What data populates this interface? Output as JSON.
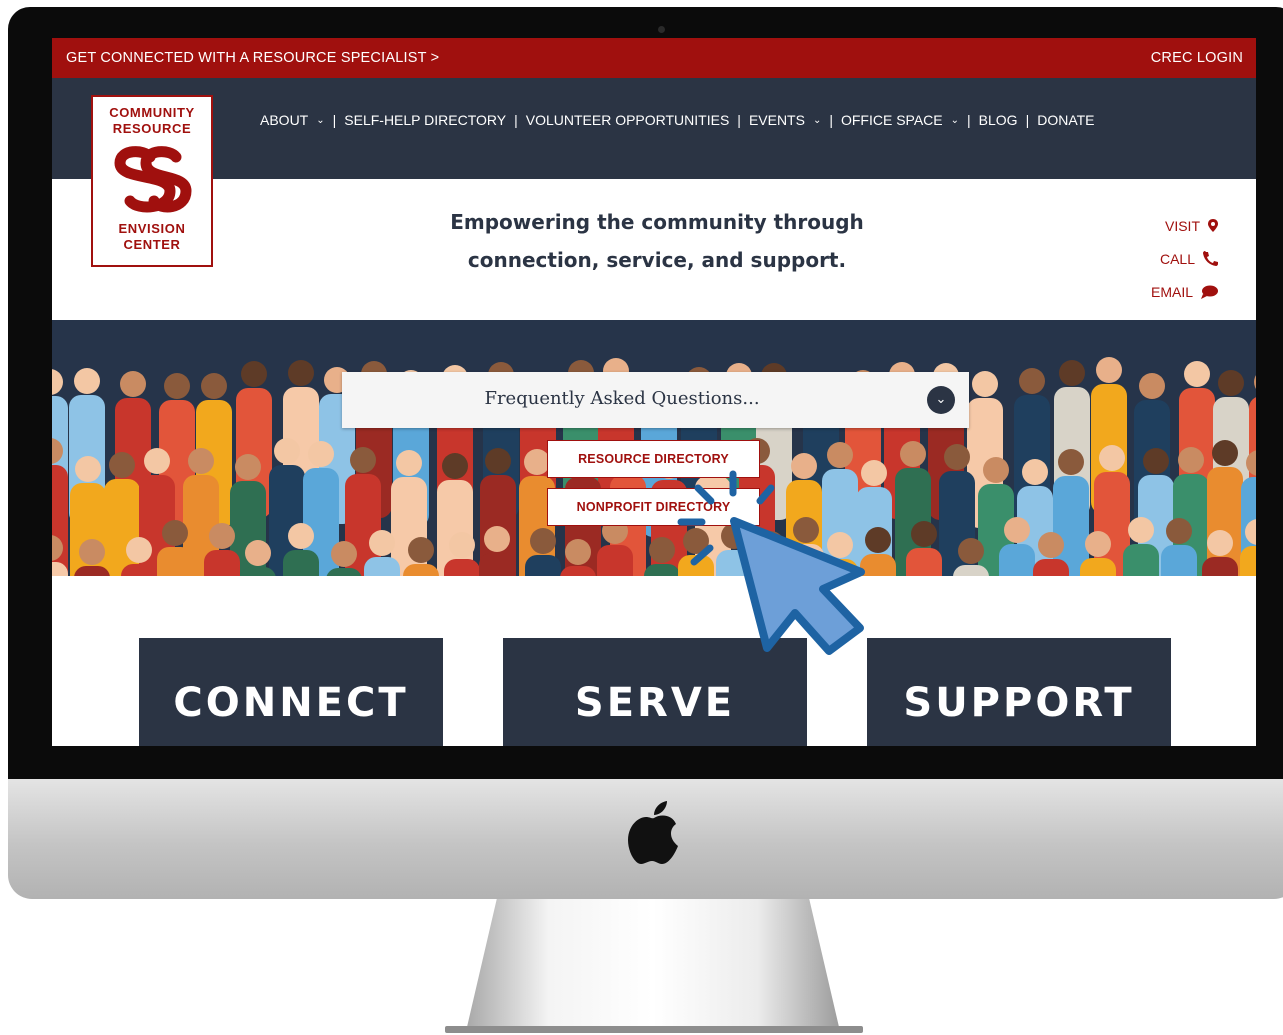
{
  "topbar": {
    "cta_label": "GET CONNECTED WITH A RESOURCE SPECIALIST >",
    "login_label": "CREC LOGIN"
  },
  "logo": {
    "line1": "COMMUNITY",
    "line2": "RESOURCE",
    "line3": "ENVISION",
    "line4": "CENTER"
  },
  "nav": {
    "items": [
      {
        "label": "ABOUT",
        "has_dropdown": true
      },
      {
        "label": "SELF-HELP DIRECTORY",
        "has_dropdown": false
      },
      {
        "label": "VOLUNTEER OPPORTUNITIES",
        "has_dropdown": false
      },
      {
        "label": "EVENTS",
        "has_dropdown": true
      },
      {
        "label": "OFFICE SPACE",
        "has_dropdown": true
      },
      {
        "label": "BLOG",
        "has_dropdown": false
      },
      {
        "label": "DONATE",
        "has_dropdown": false
      }
    ],
    "separator": "|",
    "dropdown_glyph": "⌄"
  },
  "header": {
    "tagline_line1": "Empowering the community through",
    "tagline_line2": "connection, service, and support."
  },
  "contact": {
    "visit_label": "VISIT",
    "call_label": "CALL",
    "email_label": "EMAIL"
  },
  "hero": {
    "faq_label": "Frequently Asked Questions...",
    "faq_toggle_glyph": "⌄",
    "resource_directory_label": "RESOURCE DIRECTORY",
    "nonprofit_directory_label": "NONPROFIT DIRECTORY"
  },
  "cards": {
    "connect_label": "CONNECT",
    "serve_label": "SERVE",
    "support_label": "SUPPORT"
  },
  "colors": {
    "brand_red": "#a0100e",
    "navy": "#2b3444",
    "cursor_blue": "#6d9fd8",
    "cursor_outline": "#1e63a3"
  },
  "icons": {
    "visit": "map-pin-icon",
    "call": "phone-icon",
    "email": "chat-bubble-icon",
    "device": "apple-logo-icon",
    "pointer": "mouse-cursor-icon"
  }
}
